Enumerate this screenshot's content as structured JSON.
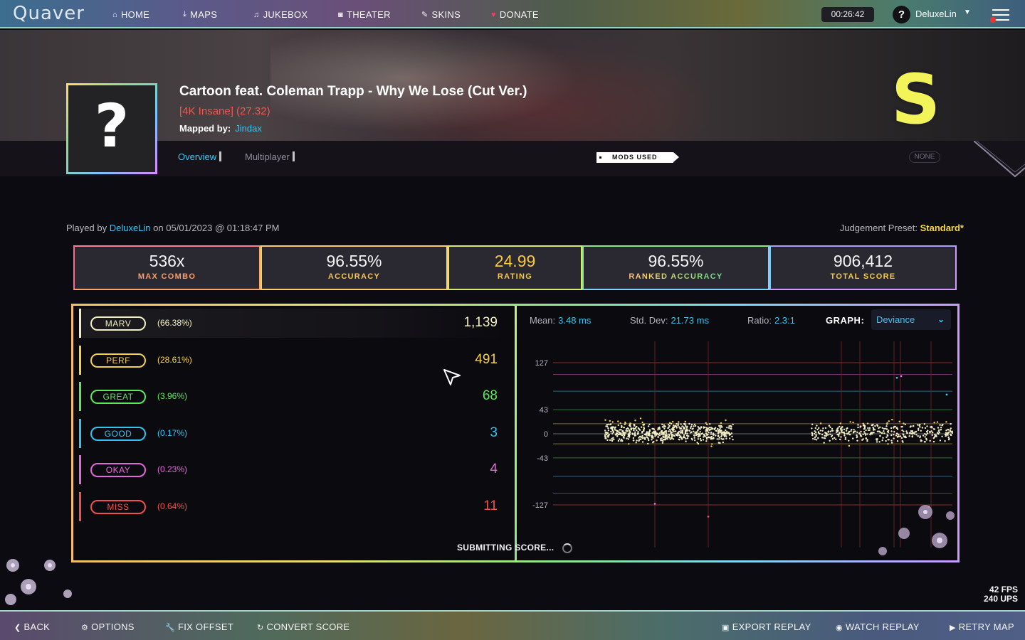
{
  "nav": {
    "logo": "Quaver",
    "items": [
      {
        "icon": "home-icon",
        "glyph": "⌂",
        "label": "HOME"
      },
      {
        "icon": "download-icon",
        "glyph": "⤓",
        "label": "MAPS"
      },
      {
        "icon": "music-icon",
        "glyph": "♫",
        "label": "JUKEBOX"
      },
      {
        "icon": "camera-icon",
        "glyph": "◙",
        "label": "THEATER"
      },
      {
        "icon": "brush-icon",
        "glyph": "✎",
        "label": "SKINS"
      },
      {
        "icon": "heart-icon",
        "glyph": "♥",
        "label": "DONATE"
      }
    ],
    "clock": "00:26:42",
    "avatar": "?",
    "username": "DeluxeLin"
  },
  "map": {
    "cover_placeholder": "?",
    "title": "Cartoon feat. Coleman Trapp - Why We Lose (Cut Ver.)",
    "difficulty": "[4K Insane] (27.32)",
    "mapped_by_label": "Mapped by:",
    "mapper": "Jindax",
    "grade": "S"
  },
  "tabs": {
    "overview": "Overview",
    "multiplayer": "Multiplayer"
  },
  "mods": {
    "tag": "MODS USED",
    "value": "NONE"
  },
  "play": {
    "played_by_label": "Played by",
    "player": "DeluxeLin",
    "on_label": "on",
    "date": "05/01/2023 @ 01:18:47 PM",
    "judgement_label": "Judgement Preset:",
    "judgement_value": "Standard*"
  },
  "stats": {
    "max_combo": {
      "value": "536x",
      "label": "MAX COMBO"
    },
    "accuracy": {
      "value": "96.55%",
      "label": "ACCURACY"
    },
    "rating": {
      "value": "24.99",
      "label": "RATING"
    },
    "ranked_accuracy": {
      "value": "96.55%",
      "label": "RANKED ACCURACY"
    },
    "total_score": {
      "value": "906,412",
      "label": "TOTAL SCORE"
    }
  },
  "judgements": [
    {
      "name": "MARV",
      "pct": "(66.38%)",
      "count": "1,139",
      "color": "#f2efc4"
    },
    {
      "name": "PERF",
      "pct": "(28.61%)",
      "count": "491",
      "color": "#f5d14a"
    },
    {
      "name": "GREAT",
      "pct": "(3.96%)",
      "count": "68",
      "color": "#5ee65e"
    },
    {
      "name": "GOOD",
      "pct": "(0.17%)",
      "count": "3",
      "color": "#31c4f2"
    },
    {
      "name": "OKAY",
      "pct": "(0.23%)",
      "count": "4",
      "color": "#e06ad8"
    },
    {
      "name": "MISS",
      "pct": "(0.64%)",
      "count": "11",
      "color": "#f2504e"
    }
  ],
  "graph": {
    "mean_label": "Mean:",
    "mean": "3.48 ms",
    "std_label": "Std. Dev:",
    "std": "21.73 ms",
    "ratio_label": "Ratio:",
    "ratio": "2.3:1",
    "graph_label": "GRAPH:",
    "graph_type": "Deviance",
    "y_ticks": [
      "127",
      "43",
      "0",
      "-43",
      "-127"
    ]
  },
  "status": {
    "submitting": "SUBMITTING SCORE..."
  },
  "perf": {
    "fps": "42 FPS",
    "ups": "240 UPS"
  },
  "bottom": {
    "back": "BACK",
    "options": "OPTIONS",
    "fix_offset": "FIX OFFSET",
    "convert_score": "CONVERT SCORE",
    "export_replay": "EXPORT REPLAY",
    "watch_replay": "WATCH REPLAY",
    "retry_map": "RETRY MAP"
  }
}
